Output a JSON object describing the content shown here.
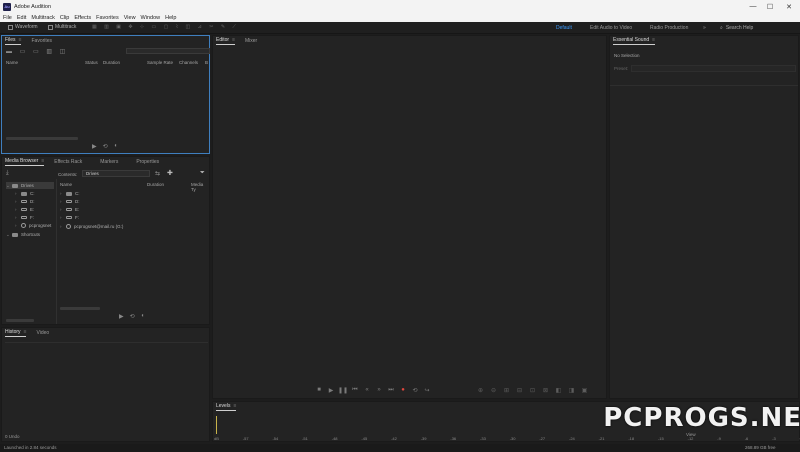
{
  "app": {
    "title": "Adobe Audition",
    "icon_label": "Au"
  },
  "window_controls": {
    "minimize": "—",
    "maximize": "☐",
    "close": "✕"
  },
  "menu": [
    "File",
    "Edit",
    "Multitrack",
    "Clip",
    "Effects",
    "Favorites",
    "View",
    "Window",
    "Help"
  ],
  "toolbar": {
    "waveform": "Waveform",
    "multitrack": "Multitrack"
  },
  "workspaces": [
    "Default",
    "Edit Audio to Video",
    "Radio Production"
  ],
  "workspace_more": "»",
  "search_help": {
    "placeholder": "Search Help"
  },
  "files_panel": {
    "tabs": [
      "Files",
      "Favorites"
    ],
    "columns": [
      "Name",
      "Status",
      "Duration",
      "Sample Rate",
      "Channels",
      "B"
    ]
  },
  "editor_panel": {
    "tabs": [
      "Editor",
      "Mixer"
    ]
  },
  "essential_sound": {
    "tab": "Essential Sound",
    "no_selection": "No Selection",
    "preset_label": "Preset:"
  },
  "media_browser": {
    "tabs": [
      "Media Browser",
      "Effects Rack",
      "Markers",
      "Properties"
    ],
    "contents_label": "Contents:",
    "contents_value": "Drives",
    "columns": [
      "Name",
      "Duration",
      "Media Ty"
    ],
    "tree": [
      "Drives",
      "C:",
      "D:",
      "E:",
      "F:",
      "pcprogsnet",
      "Shortcuts"
    ],
    "list": [
      "C:",
      "D:",
      "E:",
      "F:",
      "pcprogsnet@mail.ru (G:)"
    ]
  },
  "history_panel": {
    "tabs": [
      "History",
      "Video"
    ],
    "undo_count": "0 Undo"
  },
  "levels_panel": {
    "tab": "Levels",
    "scale": [
      "dB",
      "-57",
      "-54",
      "-51",
      "-48",
      "-45",
      "-42",
      "-39",
      "-36",
      "-33",
      "-30",
      "-27",
      "-24",
      "-21",
      "-18",
      "-15",
      "-12",
      "-9",
      "-6",
      "-3",
      "0"
    ]
  },
  "status": {
    "left": "Launched in 2.84 seconds",
    "right": "268.89 GB free",
    "view": "View"
  },
  "watermark": "PCPROGS.NET"
}
